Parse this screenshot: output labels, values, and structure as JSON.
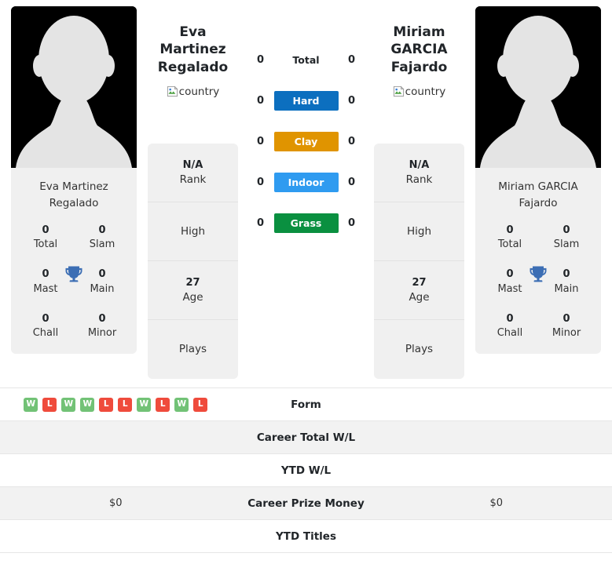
{
  "players": [
    {
      "name": "Eva Martinez Regalado",
      "name_line1": "Eva Martinez",
      "name_line2": "Regalado",
      "card_name_line1": "Eva Martinez",
      "card_name_line2": "Regalado",
      "flag_alt": "country",
      "titles": {
        "total_value": "0",
        "total_label": "Total",
        "slam_value": "0",
        "slam_label": "Slam",
        "mast_value": "0",
        "mast_label": "Mast",
        "main_value": "0",
        "main_label": "Main",
        "chall_value": "0",
        "chall_label": "Chall",
        "minor_value": "0",
        "minor_label": "Minor"
      },
      "info": {
        "rank_value": "N/A",
        "rank_label": "Rank",
        "high_value": "",
        "high_label": "High",
        "age_value": "27",
        "age_label": "Age",
        "plays_value": "",
        "plays_label": "Plays"
      }
    },
    {
      "name": "Miriam GARCIA Fajardo",
      "name_line1": "Miriam GARCIA",
      "name_line2": "Fajardo",
      "card_name_line1": "Miriam GARCIA",
      "card_name_line2": "Fajardo",
      "flag_alt": "country",
      "titles": {
        "total_value": "0",
        "total_label": "Total",
        "slam_value": "0",
        "slam_label": "Slam",
        "mast_value": "0",
        "mast_label": "Mast",
        "main_value": "0",
        "main_label": "Main",
        "chall_value": "0",
        "chall_label": "Chall",
        "minor_value": "0",
        "minor_label": "Minor"
      },
      "info": {
        "rank_value": "N/A",
        "rank_label": "Rank",
        "high_value": "",
        "high_label": "High",
        "age_value": "27",
        "age_label": "Age",
        "plays_value": "",
        "plays_label": "Plays"
      }
    }
  ],
  "surfaces": [
    {
      "label": "Total",
      "left": "0",
      "right": "0",
      "color": "transparent",
      "text_color": "#212529"
    },
    {
      "label": "Hard",
      "left": "0",
      "right": "0",
      "color": "#0c6fbf",
      "text_color": "#ffffff"
    },
    {
      "label": "Clay",
      "left": "0",
      "right": "0",
      "color": "#e09400",
      "text_color": "#ffffff"
    },
    {
      "label": "Indoor",
      "left": "0",
      "right": "0",
      "color": "#2f9bf0",
      "text_color": "#ffffff"
    },
    {
      "label": "Grass",
      "left": "0",
      "right": "0",
      "color": "#0a9040",
      "text_color": "#ffffff"
    }
  ],
  "bottom_rows": [
    {
      "label": "Form",
      "left": "",
      "right": ""
    },
    {
      "label": "Career Total W/L",
      "left": "",
      "right": ""
    },
    {
      "label": "YTD W/L",
      "left": "",
      "right": ""
    },
    {
      "label": "Career Prize Money",
      "left": "$0",
      "right": "$0"
    },
    {
      "label": "YTD Titles",
      "left": "",
      "right": ""
    }
  ],
  "form": {
    "left": [
      "W",
      "L",
      "W",
      "W",
      "L",
      "L",
      "W",
      "L",
      "W",
      "L"
    ],
    "right": [],
    "win_color": "#72c276",
    "loss_color": "#ef4b3c"
  },
  "colors": {
    "trophy": "#3c6eb4",
    "card_bg": "#f0f0f0",
    "stripe_bg": "#f2f2f2"
  }
}
